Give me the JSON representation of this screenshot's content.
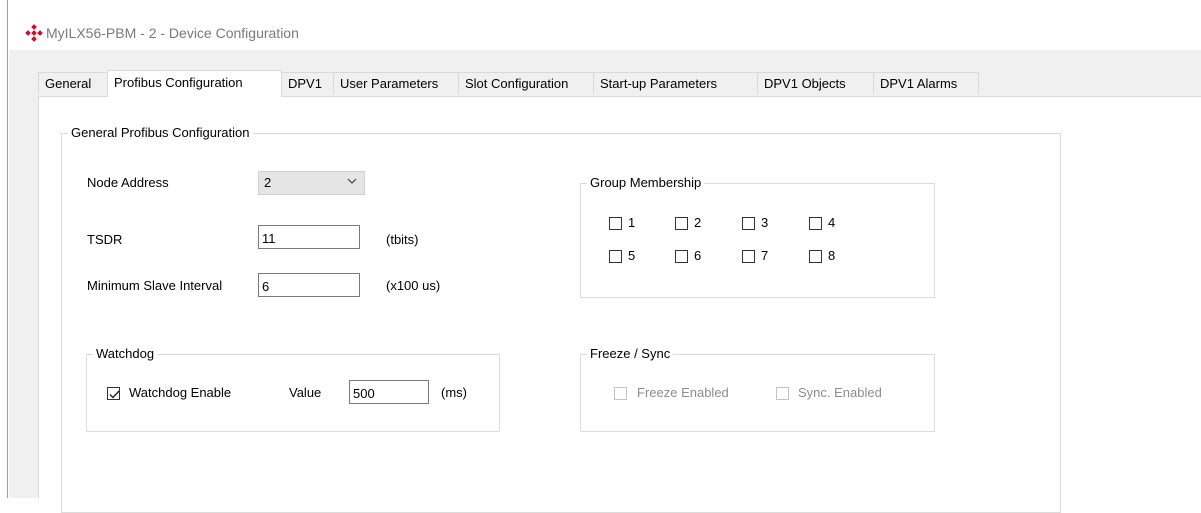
{
  "window": {
    "title": "MyILX56-PBM - 2 - Device Configuration",
    "icon": "gear-diamond-icon",
    "icon_color": "#c8102e"
  },
  "tabs": [
    {
      "label": "General"
    },
    {
      "label": "Profibus Configuration",
      "active": true
    },
    {
      "label": "DPV1"
    },
    {
      "label": "User Parameters"
    },
    {
      "label": "Slot Configuration"
    },
    {
      "label": "Start-up Parameters"
    },
    {
      "label": "DPV1 Objects"
    },
    {
      "label": "DPV1 Alarms"
    }
  ],
  "general": {
    "legend": "General Profibus Configuration",
    "node_address_label": "Node Address",
    "node_address_value": "2",
    "tsdr_label": "TSDR",
    "tsdr_value": "11",
    "tsdr_unit": "(tbits)",
    "min_slave_label": "Minimum Slave Interval",
    "min_slave_value": "6",
    "min_slave_unit": "(x100 us)"
  },
  "group": {
    "legend": "Group Membership",
    "items": [
      "1",
      "2",
      "3",
      "4",
      "5",
      "6",
      "7",
      "8"
    ]
  },
  "watchdog": {
    "legend": "Watchdog",
    "enable_label": "Watchdog Enable",
    "enable_checked": true,
    "value_label": "Value",
    "value": "500",
    "unit": "(ms)"
  },
  "freeze": {
    "legend": "Freeze / Sync",
    "freeze_label": "Freeze Enabled",
    "sync_label": "Sync. Enabled"
  }
}
